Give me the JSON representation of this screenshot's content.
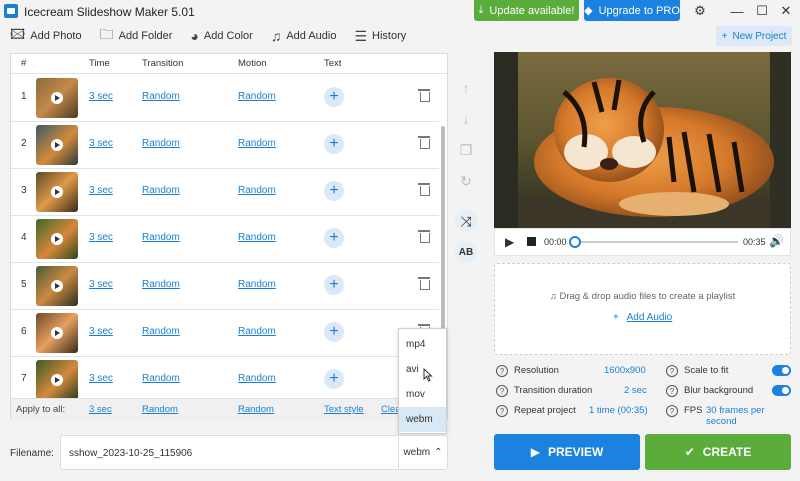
{
  "app": {
    "title": "Icecream Slideshow Maker 5.01"
  },
  "header": {
    "update_label": "Update available!",
    "pro_label": "Upgrade to PRO",
    "new_project_label": "New Project"
  },
  "toolbar": {
    "add_photo": "Add Photo",
    "add_folder": "Add Folder",
    "add_color": "Add Color",
    "add_audio": "Add Audio",
    "history": "History"
  },
  "table": {
    "columns": {
      "num": "#",
      "time": "Time",
      "transition": "Transition",
      "motion": "Motion",
      "text": "Text"
    },
    "rows": [
      {
        "num": "1",
        "time": "3 sec",
        "transition": "Random",
        "motion": "Random"
      },
      {
        "num": "2",
        "time": "3 sec",
        "transition": "Random",
        "motion": "Random"
      },
      {
        "num": "3",
        "time": "3 sec",
        "transition": "Random",
        "motion": "Random"
      },
      {
        "num": "4",
        "time": "3 sec",
        "transition": "Random",
        "motion": "Random"
      },
      {
        "num": "5",
        "time": "3 sec",
        "transition": "Random",
        "motion": "Random"
      },
      {
        "num": "6",
        "time": "3 sec",
        "transition": "Random",
        "motion": "Random"
      },
      {
        "num": "7",
        "time": "3 sec",
        "transition": "Random",
        "motion": "Random"
      }
    ],
    "apply_all": {
      "label": "Apply to all:",
      "time": "3 sec",
      "transition": "Random",
      "motion": "Random",
      "text_style": "Text style",
      "clear": "Clea"
    }
  },
  "format_dropdown": {
    "options": [
      "mp4",
      "avi",
      "mov",
      "webm"
    ],
    "selected": "webm"
  },
  "filename": {
    "label": "Filename:",
    "value": "sshow_2023-10-25_115906",
    "format": "webm"
  },
  "player": {
    "current_time": "00:00",
    "total_time": "00:35",
    "progress": 0
  },
  "audio": {
    "hint": "Drag & drop audio files to create a playlist",
    "add_label": "Add Audio"
  },
  "settings": {
    "resolution_label": "Resolution",
    "resolution_value": "1600x900",
    "transition_label": "Transition duration",
    "transition_value": "2 sec",
    "repeat_label": "Repeat project",
    "repeat_value": "1 time (00:35)",
    "scale_label": "Scale to fit",
    "blur_label": "Blur background",
    "fps_label": "FPS",
    "fps_value": "30 frames per second"
  },
  "actions": {
    "preview": "PREVIEW",
    "create": "CREATE"
  },
  "colors": {
    "accent_blue": "#1b82df",
    "accent_green": "#5aac3b",
    "link": "#1a7fd4"
  }
}
